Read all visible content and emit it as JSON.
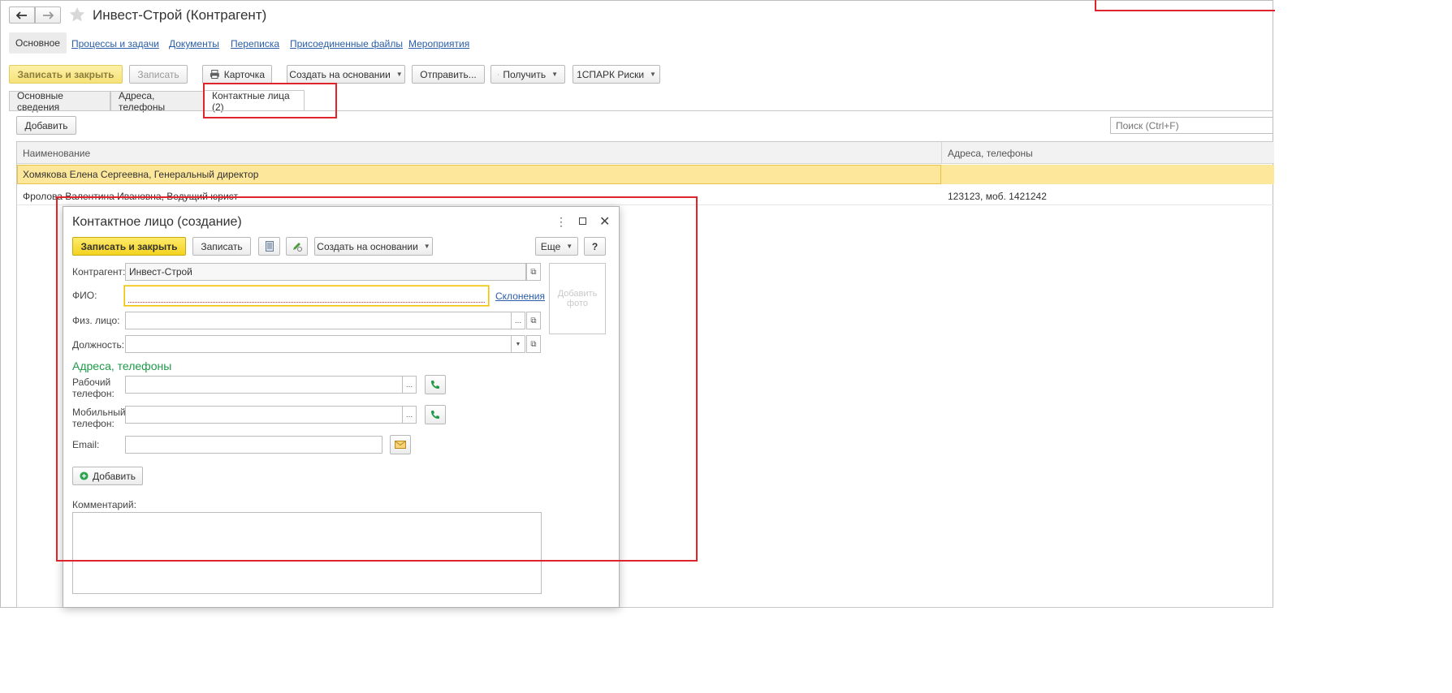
{
  "window": {
    "title": "Инвест-Строй (Контрагент)",
    "back_icon": "arrow-left-icon",
    "forward_icon": "arrow-right-icon",
    "favorite_icon": "star-icon"
  },
  "nav": {
    "items": [
      {
        "label": "Основное"
      },
      {
        "label": "Процессы и задачи"
      },
      {
        "label": "Документы"
      },
      {
        "label": "Переписка"
      },
      {
        "label": "Присоединенные файлы"
      },
      {
        "label": "Мероприятия"
      }
    ]
  },
  "toolbar": {
    "save_close": "Записать и закрыть",
    "save": "Записать",
    "card": "Карточка",
    "create_based": "Создать на основании",
    "send": "Отправить...",
    "receive": "Получить",
    "spark": "1СПАРК Риски"
  },
  "tabs": [
    {
      "label": "Основные сведения"
    },
    {
      "label": "Адреса, телефоны"
    },
    {
      "label": "Контактные лица (2)"
    }
  ],
  "list": {
    "add_button": "Добавить",
    "search_placeholder": "Поиск (Ctrl+F)",
    "columns": [
      "Наименование",
      "Адреса, телефоны"
    ],
    "rows": [
      {
        "name": "Хомякова Елена Сергеевна, Генеральный директор",
        "phones": ""
      },
      {
        "name": "Фролова Валентина Ивановна, Ведущий юрист",
        "phones": "123123, моб. 1421242"
      }
    ]
  },
  "dialog": {
    "title": "Контактное лицо (создание)",
    "save_close": "Записать и закрыть",
    "save": "Записать",
    "create_based": "Создать на основании",
    "more": "Еще",
    "help": "?",
    "counterparty_label": "Контрагент:",
    "counterparty_value": "Инвест-Строй",
    "fio_label": "ФИО:",
    "fio_value": "",
    "declension_link": "Склонения",
    "person_label": "Физ. лицо:",
    "position_label": "Должность:",
    "photo_placeholder": "Добавить фото",
    "section_title": "Адреса, телефоны",
    "work_phone_label_1": "Рабочий",
    "work_phone_label_2": "телефон:",
    "mobile_phone_label_1": "Мобильный",
    "mobile_phone_label_2": "телефон:",
    "email_label": "Email:",
    "add_button": "Добавить",
    "comment_label": "Комментарий:",
    "ellipsis": "..."
  },
  "colors": {
    "accent_yellow": "#f4d21f",
    "selected_row": "#fde79a",
    "link": "#2a5ea8",
    "section_green": "#1f9a48",
    "highlight_red": "#e0242b"
  }
}
